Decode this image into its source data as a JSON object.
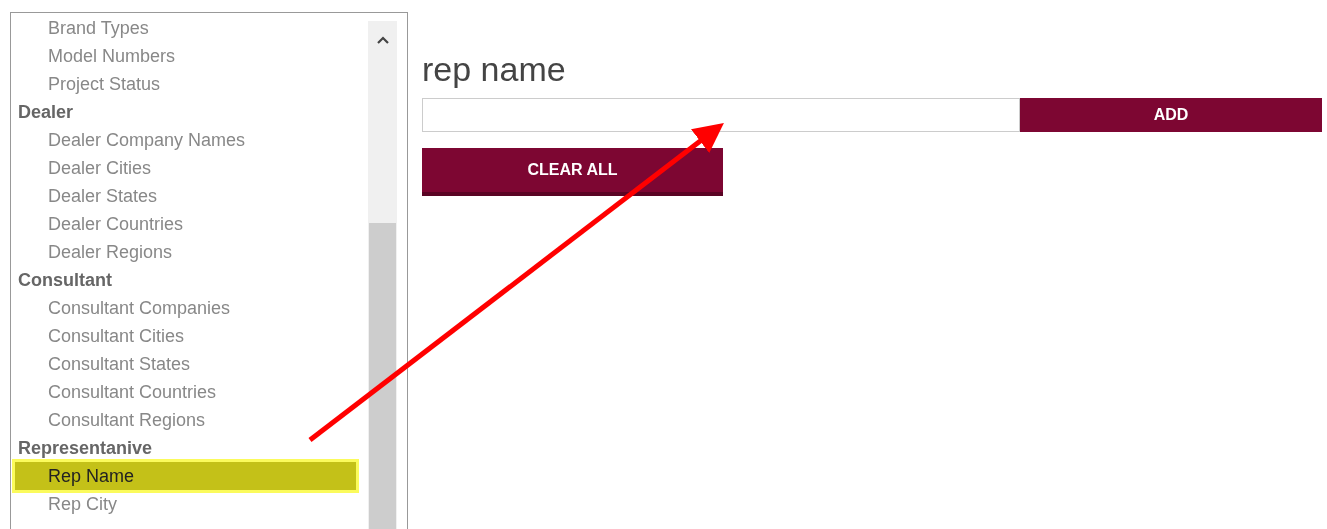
{
  "sidebar": {
    "groups": [
      {
        "children": [
          {
            "label": "Brand Types",
            "selected": false
          },
          {
            "label": "Model Numbers",
            "selected": false
          },
          {
            "label": "Project Status",
            "selected": false
          }
        ]
      },
      {
        "label": "Dealer",
        "children": [
          {
            "label": "Dealer Company Names",
            "selected": false
          },
          {
            "label": "Dealer Cities",
            "selected": false
          },
          {
            "label": "Dealer States",
            "selected": false
          },
          {
            "label": "Dealer Countries",
            "selected": false
          },
          {
            "label": "Dealer Regions",
            "selected": false
          }
        ]
      },
      {
        "label": "Consultant",
        "children": [
          {
            "label": "Consultant Companies",
            "selected": false
          },
          {
            "label": "Consultant Cities",
            "selected": false
          },
          {
            "label": "Consultant States",
            "selected": false
          },
          {
            "label": "Consultant Countries",
            "selected": false
          },
          {
            "label": "Consultant Regions",
            "selected": false
          }
        ]
      },
      {
        "label": "Representanive",
        "children": [
          {
            "label": "Rep Name",
            "selected": true
          },
          {
            "label": "Rep City",
            "selected": false
          }
        ]
      }
    ]
  },
  "panel": {
    "title": "rep name",
    "add_button": "ADD",
    "clear_button": "CLEAR ALL"
  }
}
